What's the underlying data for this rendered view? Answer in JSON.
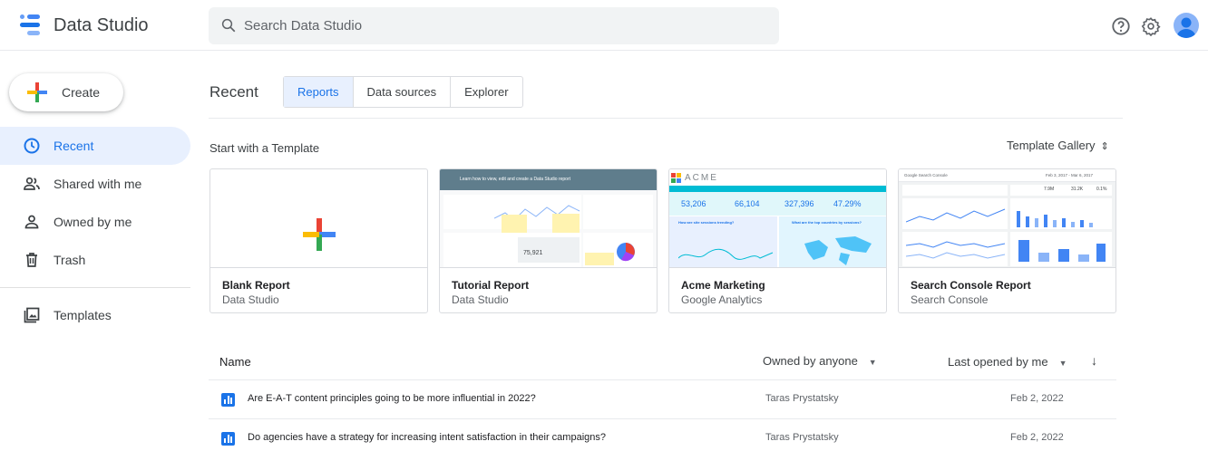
{
  "app": {
    "name": "Data Studio"
  },
  "search": {
    "placeholder": "Search Data Studio"
  },
  "header_icons": [
    "help-icon",
    "settings-icon",
    "avatar"
  ],
  "sidebar": {
    "create_label": "Create",
    "items": [
      {
        "label": "Recent",
        "icon": "clock-icon",
        "active": true
      },
      {
        "label": "Shared with me",
        "icon": "people-icon",
        "active": false
      },
      {
        "label": "Owned by me",
        "icon": "person-icon",
        "active": false
      },
      {
        "label": "Trash",
        "icon": "trash-icon",
        "active": false
      },
      {
        "label": "Templates",
        "icon": "templates-icon",
        "active": false
      }
    ]
  },
  "main": {
    "title": "Recent",
    "tabs": [
      {
        "label": "Reports",
        "active": true
      },
      {
        "label": "Data sources",
        "active": false
      },
      {
        "label": "Explorer",
        "active": false
      }
    ],
    "templates_heading": "Start with a Template",
    "gallery_label": "Template Gallery",
    "cards": [
      {
        "title": "Blank Report",
        "subtitle": "Data Studio"
      },
      {
        "title": "Tutorial Report",
        "subtitle": "Data Studio"
      },
      {
        "title": "Acme Marketing",
        "subtitle": "Google Analytics"
      },
      {
        "title": "Search Console Report",
        "subtitle": "Search Console"
      }
    ],
    "thumbs": {
      "tutorial_banner": "Learn how to view, edit and create a Data Studio report",
      "tutorial_value": "75,921",
      "acme_logo": "ACME",
      "acme_metrics": [
        "53,206",
        "66,104",
        "327,396",
        "47.29%"
      ],
      "acme_q1": "How are site sessions trending?",
      "acme_q2": "What are the top countries by sessions?",
      "sc_title": "Google Search Console",
      "sc_dates": "Feb 3, 2017 - Mar 6, 2017",
      "sc_metrics": [
        "7.9M",
        "31.2K",
        "0.1%"
      ]
    },
    "table": {
      "col_name": "Name",
      "col_owner": "Owned by anyone",
      "col_opened": "Last opened by me",
      "rows": [
        {
          "name": "Are E-A-T content principles going to be more influential in 2022?",
          "owner": "Taras Prystatsky",
          "date": "Feb 2, 2022"
        },
        {
          "name": "Do agencies have a strategy for increasing intent satisfaction in their campaigns?",
          "owner": "Taras Prystatsky",
          "date": "Feb 2, 2022"
        }
      ]
    }
  },
  "colors": {
    "blue": "#1a73e8",
    "red": "#ea4335",
    "yellow": "#fbbc04",
    "green": "#34a853",
    "active_bg": "#e8f0fe",
    "acme_teal": "#00bcd4"
  }
}
